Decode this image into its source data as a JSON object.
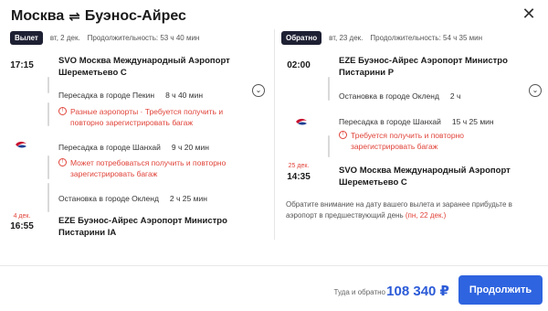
{
  "header": {
    "from": "Москва",
    "swap_icon": "⇌",
    "to": "Буэнос-Айрес"
  },
  "outbound": {
    "badge": "Вылет",
    "date": "вт, 2 дек.",
    "duration": "Продолжительность: 53 ч 40 мин",
    "dep_time": "17:15",
    "dep_airport": "SVO Москва Международный Аэропорт Шереметьево C",
    "transfer1_label": "Пересадка в городе Пекин",
    "transfer1_dur": "8 ч 40 мин",
    "transfer1_warn": "Разные аэропорты · Требуется получить и повторно зарегистрировать багаж",
    "transfer2_label": "Пересадка в городе Шанхай",
    "transfer2_dur": "9 ч 20 мин",
    "transfer2_warn": "Может потребоваться получить и повторно зарегистрировать багаж",
    "stop_label": "Остановка в городе Окленд",
    "stop_dur": "2 ч 25 мин",
    "arr_date": "4 дек.",
    "arr_time": "16:55",
    "arr_airport": "EZE Буэнос-Айрес Аэропорт Министро Пистарини IA"
  },
  "inbound": {
    "badge": "Обратно",
    "date": "вт, 23 дек.",
    "duration": "Продолжительность: 54 ч 35 мин",
    "dep_time": "02:00",
    "dep_airport": "EZE Буэнос-Айрес Аэропорт Министро Пистарини P",
    "stop_label": "Остановка в городе Окленд",
    "stop_dur": "2 ч",
    "transfer_label": "Пересадка в городе Шанхай",
    "transfer_dur": "15 ч 25 мин",
    "transfer_warn": "Требуется получить и повторно зарегистрировать багаж",
    "arr_date": "25 дек.",
    "arr_time": "14:35",
    "arr_airport": "SVO Москва Международный Аэропорт Шереметьево C",
    "note": "Обратите внимание на дату вашего вылета и заранее прибудьте в аэропорт в предшествующий день",
    "note_highlight": "(пн, 22 дек.)"
  },
  "footer": {
    "price_label": "Туда и обратно",
    "price": "108 340 ₽",
    "book_label": "Продолжить"
  },
  "icons": {
    "close": "close-icon",
    "chevron": "chevron-down-icon",
    "warning": "warning-icon",
    "airline": "china-eastern-logo"
  },
  "colors": {
    "accent": "#2f64e0",
    "warning": "#e0443a",
    "badge_bg": "#1e2033"
  }
}
